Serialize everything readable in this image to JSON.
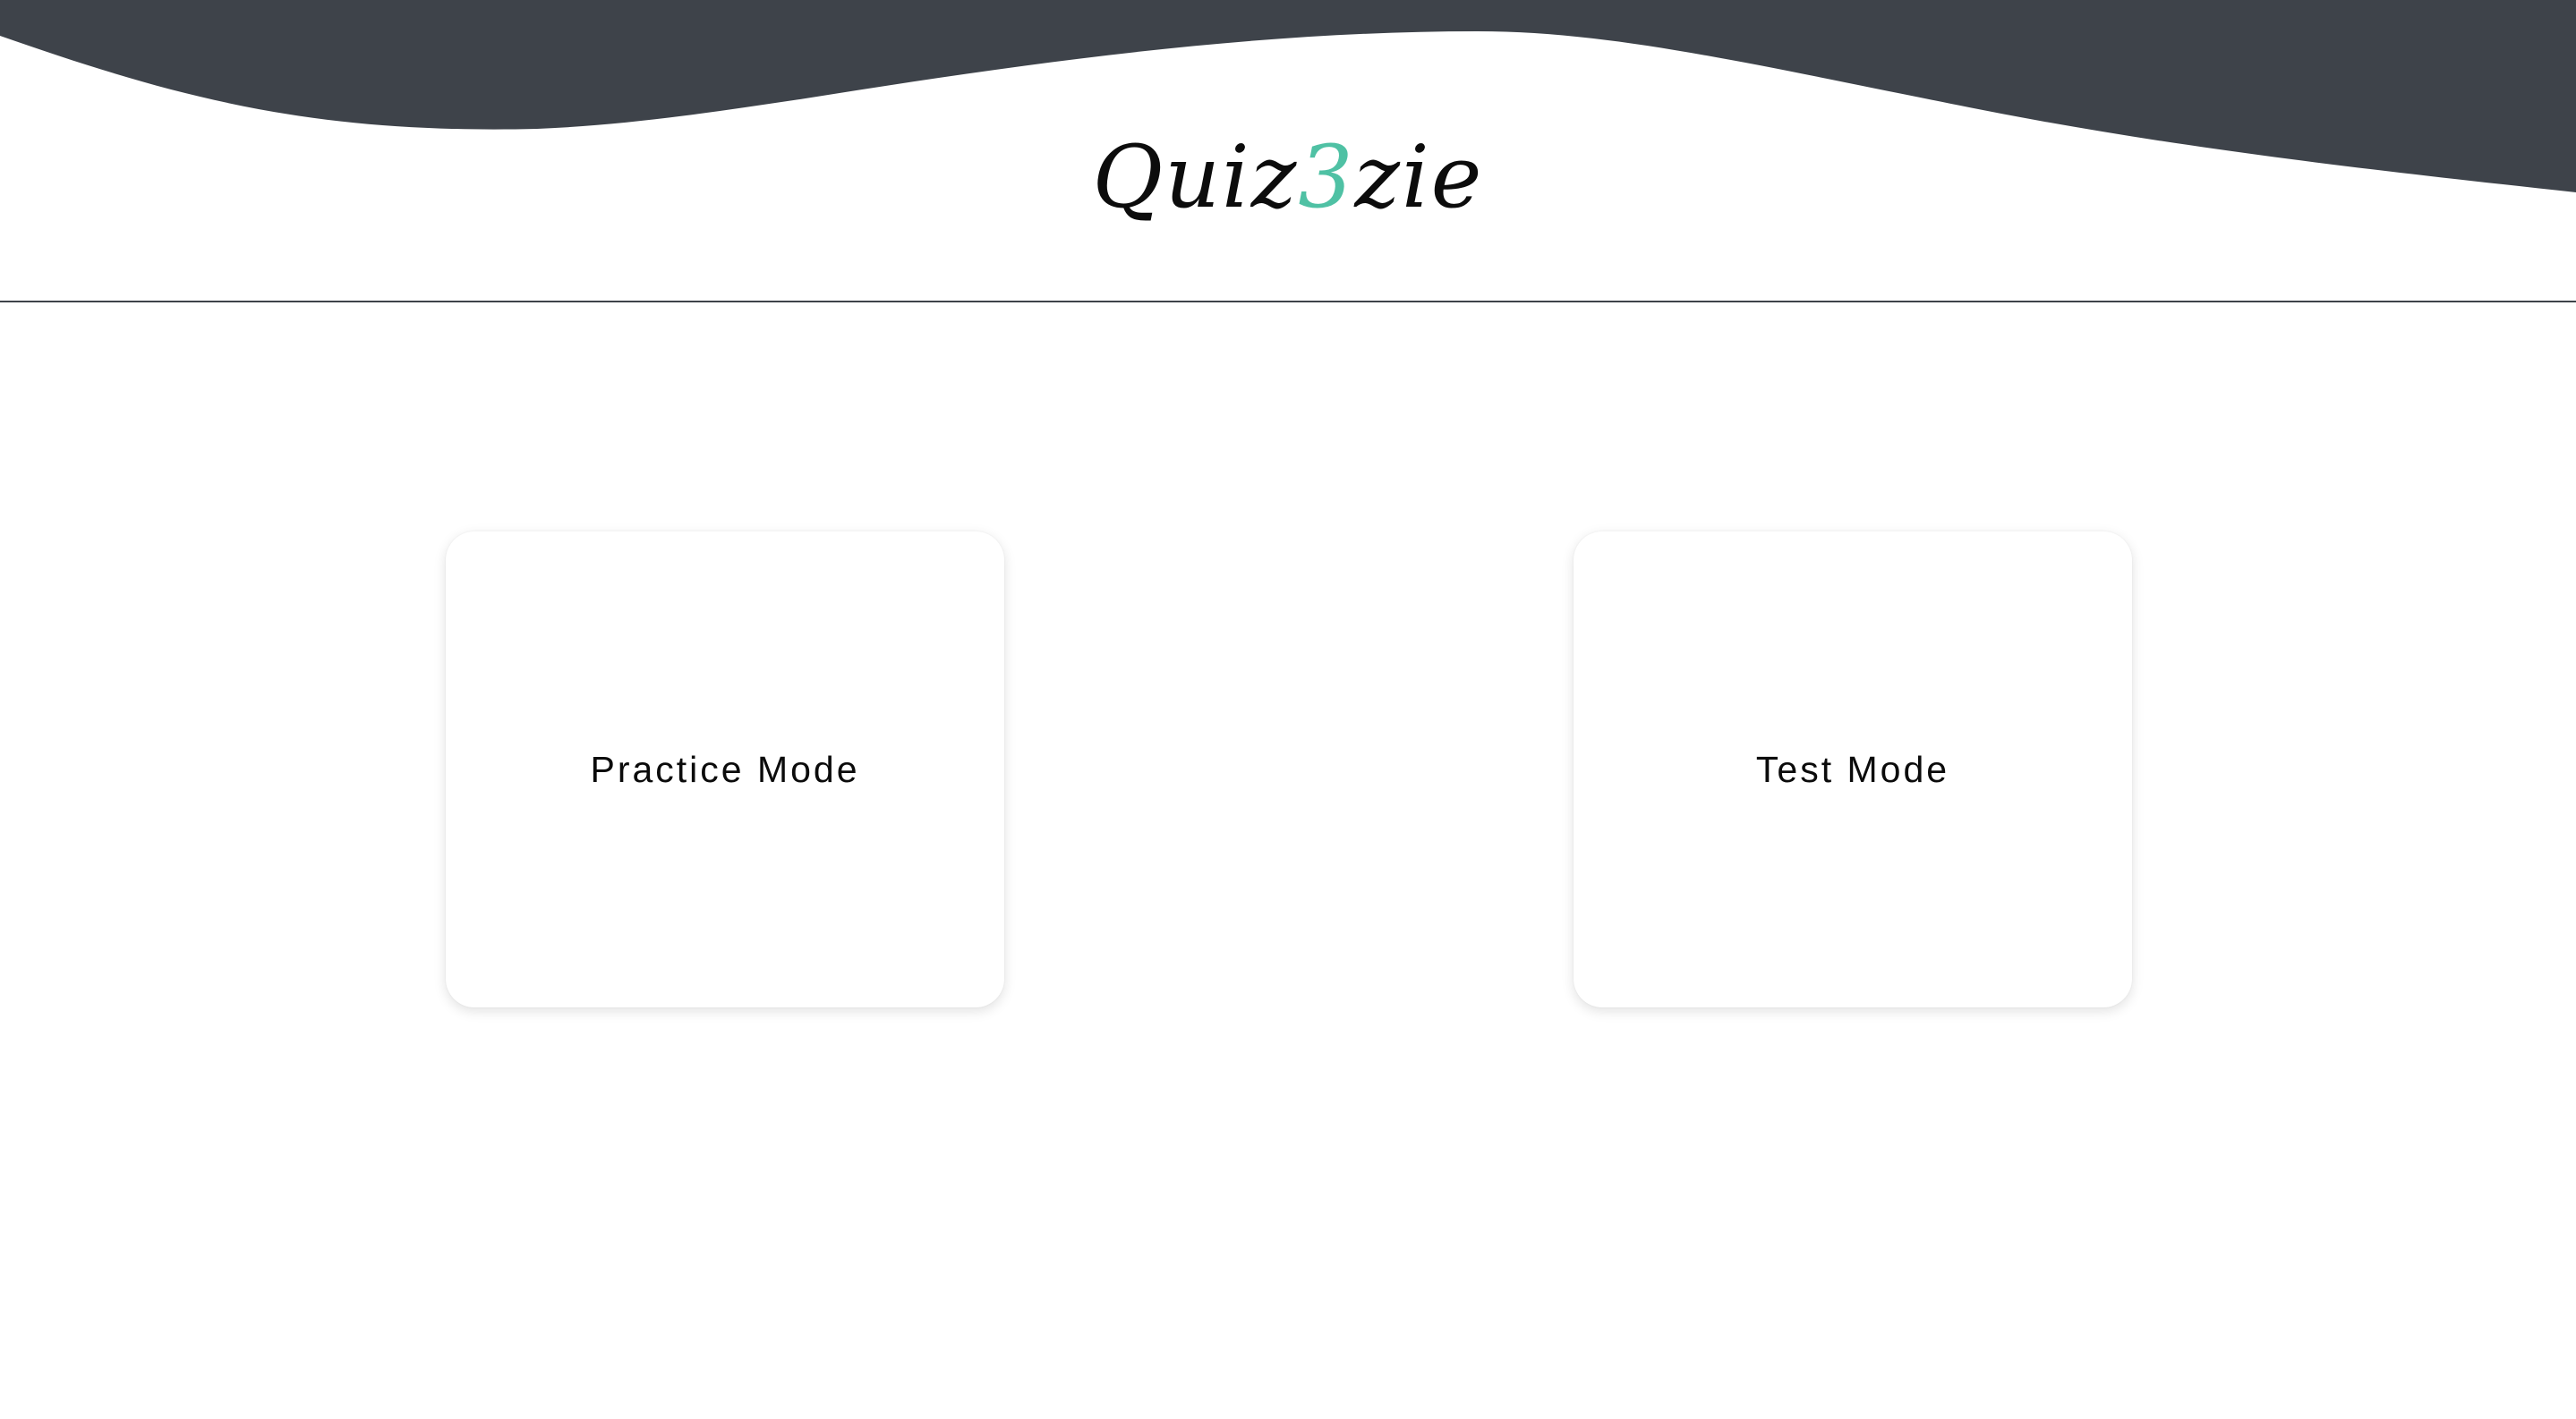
{
  "header": {
    "logo": {
      "prefix": "Quiz",
      "accent": "3",
      "suffix": "zie"
    },
    "wave_color": "#3e434a",
    "accent_color": "#4fc1a4"
  },
  "modes": {
    "practice_label": "Practice Mode",
    "test_label": "Test Mode"
  }
}
